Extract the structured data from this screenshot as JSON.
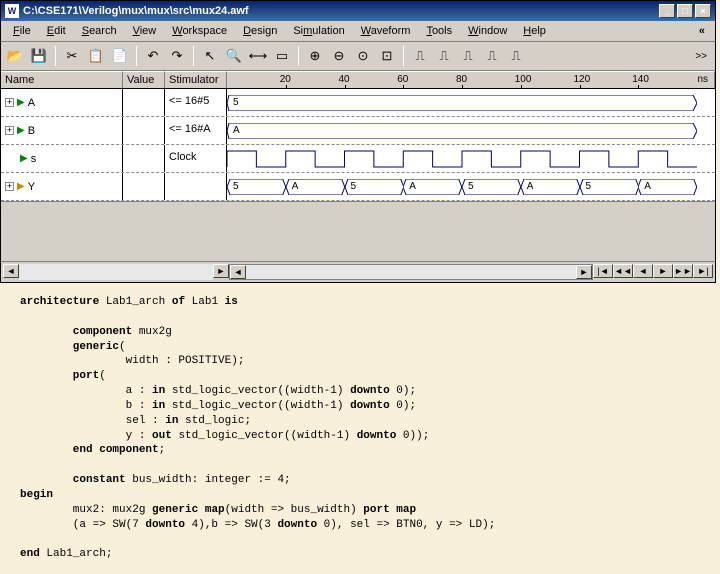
{
  "titlebar": {
    "icon_label": "W",
    "path": "C:\\CSE171\\Verilog\\mux\\mux\\src\\mux24.awf"
  },
  "menus": [
    "File",
    "Edit",
    "Search",
    "View",
    "Workspace",
    "Design",
    "Simulation",
    "Waveform",
    "Tools",
    "Window",
    "Help"
  ],
  "menu_underline_index": [
    0,
    0,
    0,
    0,
    0,
    0,
    2,
    0,
    0,
    0,
    0
  ],
  "chevron": "«",
  "toolbar_overflow": ">>",
  "headers": {
    "name": "Name",
    "value": "Value",
    "stim": "Stimulator",
    "unit": "ns"
  },
  "ticks": [
    20,
    40,
    60,
    80,
    100,
    120,
    140
  ],
  "signals": [
    {
      "name": "A",
      "stim": "<= 16#5",
      "value": "",
      "type": "bus",
      "labels": [
        "5"
      ],
      "expandable": true,
      "dir": "in"
    },
    {
      "name": "B",
      "stim": "<= 16#A",
      "value": "",
      "type": "bus",
      "labels": [
        "A"
      ],
      "expandable": true,
      "dir": "in"
    },
    {
      "name": "s",
      "stim": "Clock",
      "value": "",
      "type": "clock",
      "expandable": false,
      "dir": "in"
    },
    {
      "name": "Y",
      "stim": "",
      "value": "",
      "type": "mux",
      "labels": [
        "5",
        "A",
        "5",
        "A",
        "5",
        "A",
        "5",
        "A"
      ],
      "expandable": true,
      "dir": "out"
    }
  ],
  "nav_buttons": [
    "|◄",
    "◄◄",
    "◄",
    "►",
    "►►",
    "►|"
  ],
  "code": {
    "l1a": "architecture",
    "l1b": " Lab1_arch ",
    "l1c": "of",
    "l1d": " Lab1 ",
    "l1e": "is",
    "l2a": "        component",
    "l2b": " mux2g",
    "l3a": "        generic",
    "l3b": "(",
    "l4": "                width : POSITIVE);",
    "l5a": "        port",
    "l5b": "(",
    "l6a": "                a : ",
    "l6b": "in",
    "l6c": " std_logic_vector((width-1) ",
    "l6d": "downto",
    "l6e": " 0);",
    "l7a": "                b : ",
    "l7b": "in",
    "l7c": " std_logic_vector((width-1) ",
    "l7d": "downto",
    "l7e": " 0);",
    "l8a": "                sel : ",
    "l8b": "in",
    "l8c": " std_logic;",
    "l9a": "                y : ",
    "l9b": "out",
    "l9c": " std_logic_vector((width-1) ",
    "l9d": "downto",
    "l9e": " 0));",
    "l10a": "        end component",
    "l10b": ";",
    "l11a": "        constant",
    "l11b": " bus_width: integer := 4;",
    "l12": "begin",
    "l13a": "        mux2: mux2g ",
    "l13b": "generic map",
    "l13c": "(width => bus_width) ",
    "l13d": "port map",
    "l14a": "        (a => SW(7 ",
    "l14b": "downto",
    "l14c": " 4),b => SW(3 ",
    "l14d": "downto",
    "l14e": " 0), sel => BTN0, y => LD);",
    "l15a": "end",
    "l15b": " Lab1_arch;"
  }
}
